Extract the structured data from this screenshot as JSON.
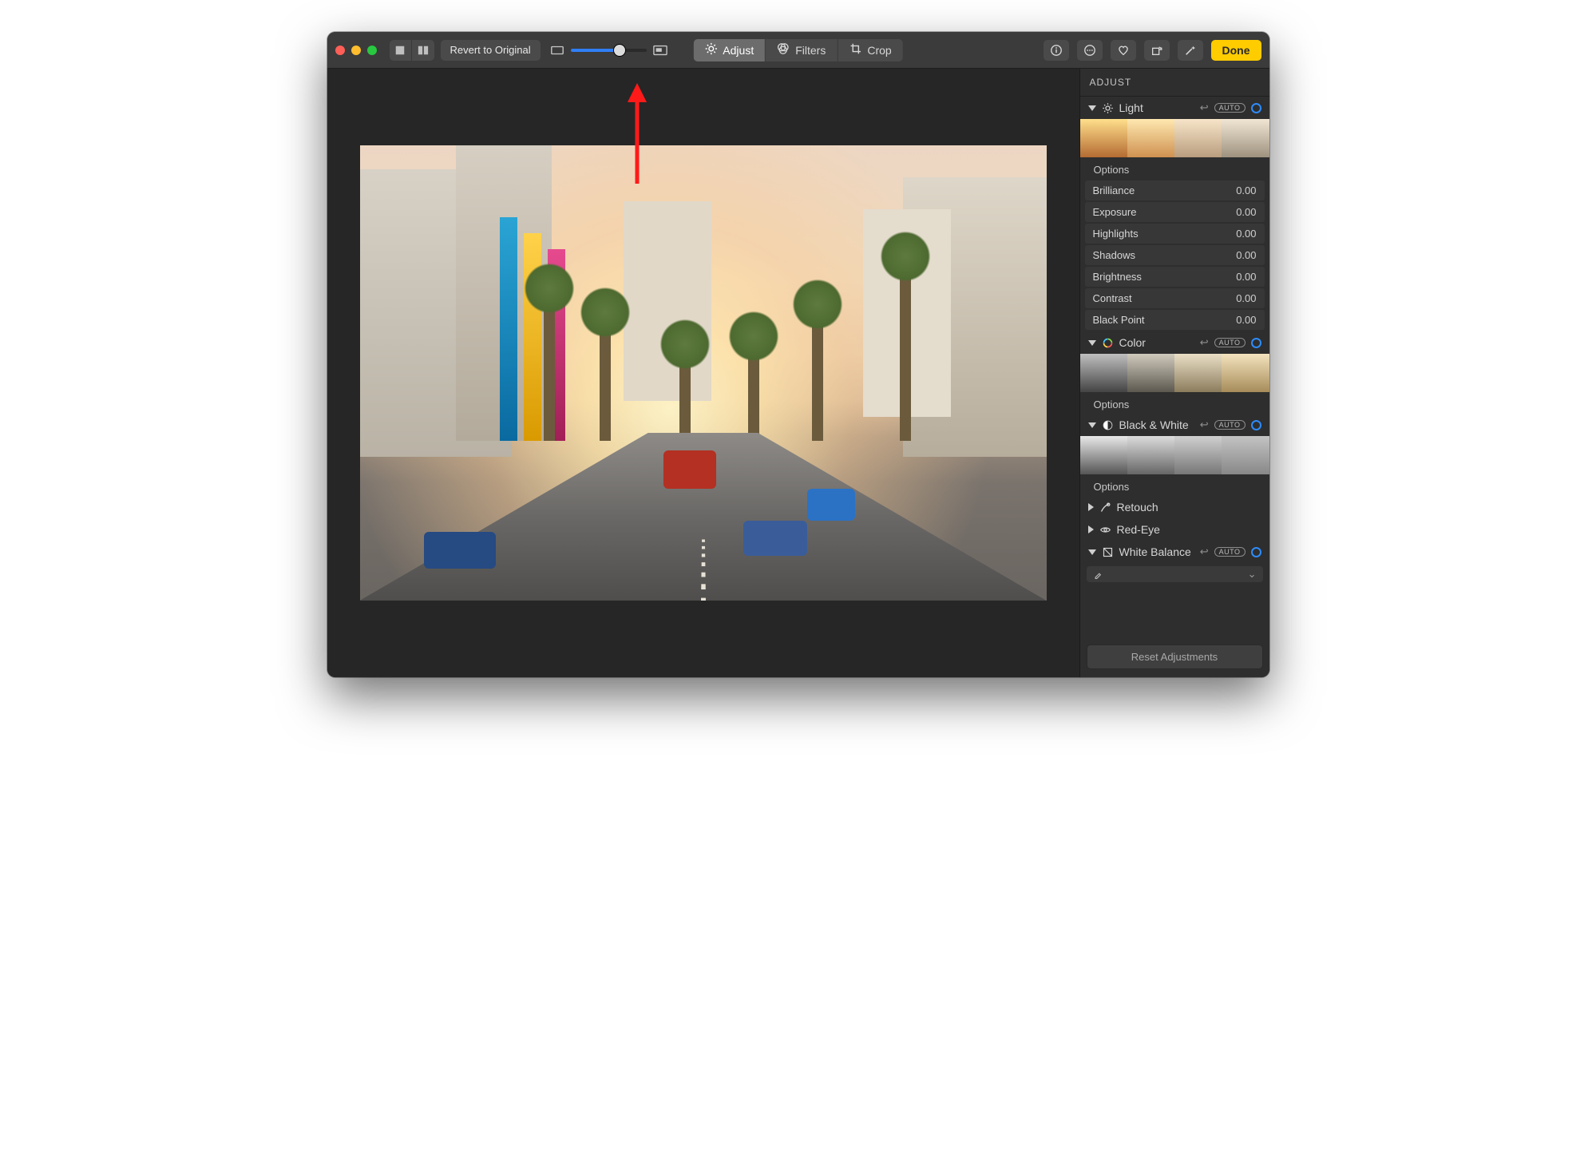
{
  "toolbar": {
    "revert_label": "Revert to Original",
    "tabs": {
      "adjust": "Adjust",
      "filters": "Filters",
      "crop": "Crop"
    },
    "done_label": "Done"
  },
  "inspector": {
    "title": "ADJUST",
    "auto_badge": "AUTO",
    "options_label": "Options",
    "reset_label": "Reset Adjustments",
    "light": {
      "label": "Light",
      "sliders": [
        {
          "label": "Brilliance",
          "value": "0.00"
        },
        {
          "label": "Exposure",
          "value": "0.00"
        },
        {
          "label": "Highlights",
          "value": "0.00"
        },
        {
          "label": "Shadows",
          "value": "0.00"
        },
        {
          "label": "Brightness",
          "value": "0.00"
        },
        {
          "label": "Contrast",
          "value": "0.00"
        },
        {
          "label": "Black Point",
          "value": "0.00"
        }
      ]
    },
    "color": {
      "label": "Color"
    },
    "bw": {
      "label": "Black & White"
    },
    "retouch": {
      "label": "Retouch"
    },
    "redeye": {
      "label": "Red-Eye"
    },
    "wb": {
      "label": "White Balance"
    }
  }
}
